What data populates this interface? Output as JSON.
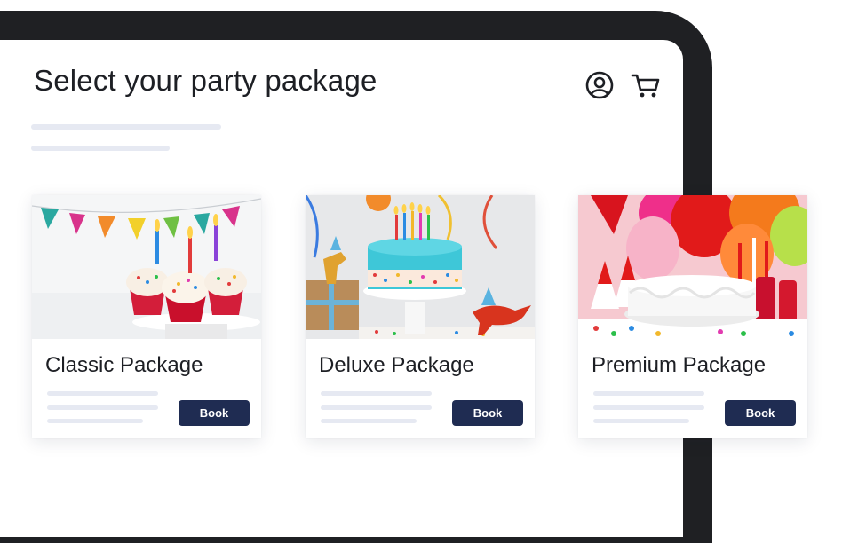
{
  "page": {
    "title": "Select your party package"
  },
  "header": {
    "icons": [
      "user-circle-icon",
      "cart-icon"
    ]
  },
  "packages": [
    {
      "name": "Classic Package",
      "button_label": "Book",
      "image": "cupcakes-with-candles"
    },
    {
      "name": "Deluxe Package",
      "button_label": "Book",
      "image": "blue-birthday-cake-with-dinosaurs"
    },
    {
      "name": "Premium Package",
      "button_label": "Book",
      "image": "white-cake-with-balloons"
    }
  ],
  "colors": {
    "frame": "#1f2023",
    "button": "#1f2c52",
    "placeholder": "#e6e9f2",
    "text": "#1d1f24"
  }
}
